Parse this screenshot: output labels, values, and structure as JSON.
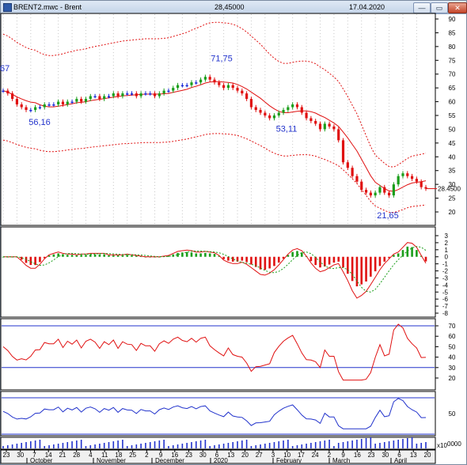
{
  "window": {
    "title": "BRENT2.mwc - Brent",
    "last_price": "28,45000",
    "date": "17.04.2020",
    "buttons": {
      "minimize": "—",
      "maximize": "▭",
      "close": "✕"
    }
  },
  "price_panel": {
    "y_ticks": [
      "90",
      "85",
      "80",
      "75",
      "70",
      "65",
      "60",
      "55",
      "50",
      "45",
      "40",
      "35",
      "30",
      "25",
      "20"
    ],
    "last_label": "28.4500",
    "annotations": [
      {
        "text": "67",
        "value": 67
      },
      {
        "text": "56,16",
        "value": 56.16
      },
      {
        "text": "71,75",
        "value": 71.75
      },
      {
        "text": "53,11",
        "value": 53.11
      },
      {
        "text": "21,65",
        "value": 21.65
      }
    ],
    "closes": [
      64,
      63,
      61,
      59,
      58,
      57,
      57,
      58,
      58,
      59,
      59,
      59,
      60,
      59,
      60,
      60,
      61,
      60,
      61,
      62,
      62,
      61,
      62,
      62,
      63,
      62,
      63,
      63,
      63,
      62,
      63,
      63,
      63,
      62,
      63,
      64,
      64,
      65,
      66,
      66,
      66,
      67,
      67,
      68,
      69,
      68,
      67,
      66,
      65,
      66,
      65,
      64,
      63,
      61,
      58,
      57,
      56,
      55,
      54,
      55,
      56,
      57,
      58,
      59,
      58,
      56,
      54,
      53,
      52,
      50,
      52,
      51,
      50,
      46,
      38,
      36,
      33,
      31,
      28,
      27,
      26,
      27,
      29,
      27,
      26,
      30,
      33,
      34,
      33,
      32,
      31,
      29,
      28.45
    ],
    "colors": {
      "up": "#1a9e1a",
      "down": "#e01010",
      "neutral": "#1a2ad8",
      "ma": "#e01010",
      "envelope": "#e01010"
    }
  },
  "macd_panel": {
    "y_ticks": [
      "3",
      "2",
      "1",
      "0",
      "-1",
      "-2",
      "-3",
      "-4",
      "-5",
      "-6",
      "-7",
      "-8"
    ]
  },
  "rsi_panel": {
    "y_ticks": [
      "70",
      "60",
      "50",
      "40",
      "30",
      "20"
    ],
    "levels": [
      70,
      30
    ]
  },
  "osc_panel": {
    "y_ticks": [
      "50"
    ]
  },
  "volume_panel": {
    "y_ticks": [
      "0000"
    ],
    "scale_label": "x10"
  },
  "time_axis": {
    "day_labels": [
      "23",
      "30",
      "7",
      "14",
      "21",
      "28",
      "4",
      "11",
      "18",
      "25",
      "2",
      "9",
      "16",
      "23",
      "30",
      "6",
      "13",
      "20",
      "27",
      "3",
      "10",
      "17",
      "24",
      "2",
      "9",
      "16",
      "23",
      "30",
      "6",
      "13",
      "20"
    ],
    "month_labels": [
      "October",
      "November",
      "December",
      "2020",
      "February",
      "March",
      "April"
    ]
  }
}
